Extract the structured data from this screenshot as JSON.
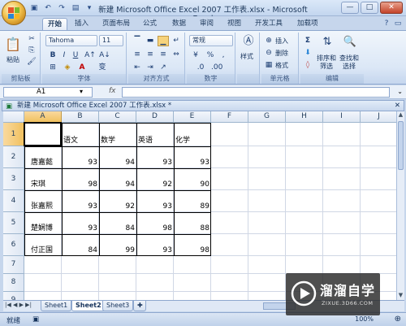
{
  "window": {
    "title": "新建 Microsoft Office Excel 2007 工作表.xlsx - Microsoft Excel",
    "controls": [
      "—",
      "□",
      "✕"
    ]
  },
  "ribbon_tabs": [
    "开始",
    "插入",
    "页面布局",
    "公式",
    "数据",
    "审阅",
    "视图",
    "开发工具",
    "加载项"
  ],
  "active_tab": "开始",
  "ribbon": {
    "clipboard": {
      "paste": "粘贴",
      "label": "剪贴板"
    },
    "font": {
      "name": "Tahoma",
      "size": "11",
      "label": "字体",
      "bold": "B",
      "italic": "I",
      "underline": "U",
      "font_color_glyph": "A",
      "wen": "变"
    },
    "alignment": {
      "label": "对齐方式"
    },
    "number": {
      "format": "常规",
      "percent": "%",
      "comma": ",",
      "label": "数字"
    },
    "styles": {
      "button": "样式"
    },
    "cells": {
      "insert": "插入",
      "delete": "删除",
      "format": "格式",
      "label": "单元格"
    },
    "editing": {
      "sum": "Σ",
      "sort_filter": "排序和筛选",
      "find_select": "查找和选择",
      "label": "编辑"
    }
  },
  "formula_bar": {
    "name_box": "A1",
    "fx": "fx",
    "value": ""
  },
  "workbook_title": "新建 Microsoft Office Excel 2007 工作表.xlsx *",
  "columns": [
    "A",
    "B",
    "C",
    "D",
    "E",
    "F",
    "G",
    "H",
    "I",
    "J"
  ],
  "rows": [
    "1",
    "2",
    "3",
    "4",
    "5",
    "6",
    "7",
    "8",
    "9"
  ],
  "table": {
    "headers": [
      "",
      "语文",
      "数学",
      "英语",
      "化学"
    ],
    "data": [
      [
        "唐嘉懿",
        93,
        94,
        93,
        93
      ],
      [
        "宋琪",
        98,
        94,
        92,
        90
      ],
      [
        "张嘉熙",
        93,
        92,
        93,
        89
      ],
      [
        "楚娴博",
        93,
        84,
        98,
        88
      ],
      [
        "付正国",
        84,
        99,
        93,
        98
      ]
    ]
  },
  "sheet_tabs": [
    "Sheet1",
    "Sheet2",
    "Sheet3"
  ],
  "active_sheet": "Sheet2",
  "status": {
    "ready": "就绪",
    "zoom": "100%"
  },
  "watermark": {
    "brand": "溜溜自学",
    "url": "ZIXUE.3D66.COM"
  },
  "colors": {
    "selected_header": "#f1c15f",
    "ribbon_bg": "#dbe7f6",
    "grid": "#d0d7e5"
  }
}
